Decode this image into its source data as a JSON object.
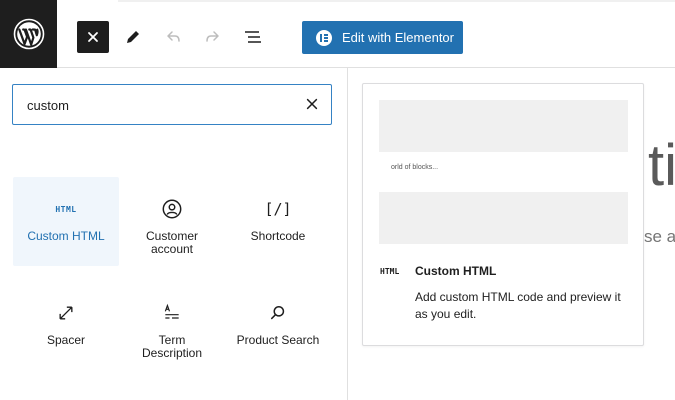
{
  "topbar": {
    "logo_icon": "wordpress-logo-icon",
    "tools": [
      {
        "name": "close-icon"
      },
      {
        "name": "pencil-icon"
      },
      {
        "name": "undo-icon"
      },
      {
        "name": "redo-icon"
      },
      {
        "name": "list-view-icon"
      }
    ],
    "elementor_button": "Edit with Elementor",
    "accent": "#2271b1"
  },
  "search": {
    "value": "custom",
    "placeholder": ""
  },
  "blocks": [
    {
      "label": "Custom HTML",
      "icon": "html-icon",
      "glyph": "HTML",
      "active": true
    },
    {
      "label": "Customer account",
      "icon": "user-circle-icon",
      "active": false
    },
    {
      "label": "Shortcode",
      "icon": "shortcode-icon",
      "glyph": "[/]",
      "active": false
    },
    {
      "label": "Spacer",
      "icon": "resize-arrow-icon",
      "active": false
    },
    {
      "label": "Term Description",
      "icon": "term-description-icon",
      "active": false
    },
    {
      "label": "Product Search",
      "icon": "search-icon",
      "active": false
    }
  ],
  "preview": {
    "placeholder_text": "orld of blocks...",
    "icon_glyph": "HTML",
    "title": "Custom HTML",
    "description": "Add custom HTML code and preview it as you edit."
  },
  "canvas": {
    "title_fragment": "ti",
    "subtitle_fragment": "se a"
  }
}
